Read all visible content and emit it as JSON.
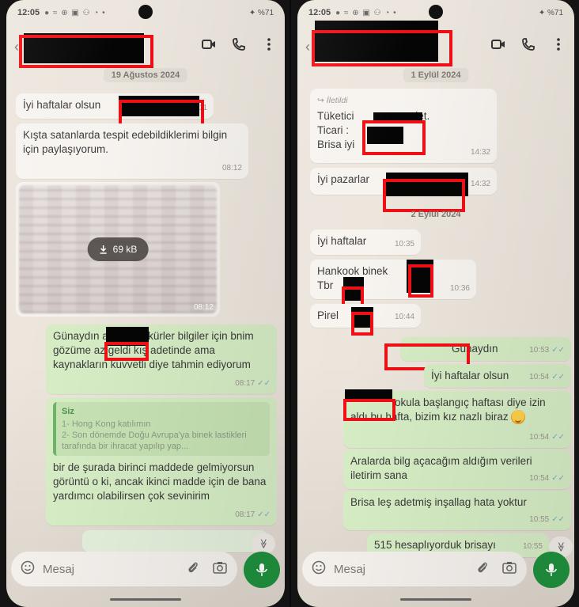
{
  "left": {
    "status": {
      "time": "12:05",
      "icons": "● ≈ ⊕ ▣ ⚇ ◔ •",
      "battery": "✦ %71"
    },
    "date_chip": "19 Ağustos 2024",
    "messages": [
      {
        "text": "İyi haftalar olsun",
        "time": "08:11"
      },
      {
        "text": "Kışta satanlarda tespit edebildiklerimi bilgin için paylaşıyorum.",
        "time": "08:12"
      },
      {
        "download_size": "69 kB",
        "time": "08:12"
      },
      {
        "text": "Günaydın abi, teşekkürler bilgiler için bnim gözüme az geldi kış adetinde ama kaynakların kuvvetli diye tahmin ediyorum",
        "time": "08:17"
      },
      {
        "quote_author": "Siz",
        "quote_line1": "1- Hong Kong katılımın",
        "quote_line2": "2- Son dönemde Doğu Avrupa'ya binek lastikleri tarafında bir ihracat yapılıp yap...",
        "text": "bir de şurada birinci maddede gelmiyorsun görüntü o ki, ancak ikinci madde için de bana yardımcı olabilirsen çok sevinirim",
        "time": "08:17"
      }
    ],
    "composer_placeholder": "Mesaj",
    "scroll_icon": "≫"
  },
  "right": {
    "status": {
      "time": "12:05",
      "icons": "● ≈ ⊕ ▣ ⚇ ◔ •",
      "battery": "✦ %71"
    },
    "date_chip_1": "1 Eylül 2024",
    "date_chip_2": "2 Eylül 2024",
    "messages": [
      {
        "forwarded": "İletildi",
        "line1": "Tüketici",
        "line1_end": "adet.",
        "line2": "Ticari :",
        "line3": "Brisa iyi",
        "time": "14:32"
      },
      {
        "text": "İyi pazarlar",
        "time": "14:32"
      },
      {
        "text": "İyi haftalar",
        "time": "10:35"
      },
      {
        "line1": "Hankook binek",
        "line2": "Tbr",
        "time": "10:36"
      },
      {
        "text": "Pirel",
        "time": "10:44"
      },
      {
        "text": "Günaydın",
        "time": "10:53"
      },
      {
        "text": "İyi haftalar olsun",
        "time": "10:54"
      },
      {
        "text_a": "okula başlangıç haftası diye",
        "text_b": "izin aldı",
        "text_c": "bu hafta, bizim kız nazlı biraz",
        "time": "10:54"
      },
      {
        "text": "Aralarda bilg açacağım aldığım verileri iletirim sana",
        "time": "10:54"
      },
      {
        "text": "Brisa leş adetmiş inşallag hata yoktur",
        "time": "10:55"
      },
      {
        "text": "515 hesaplıyorduk brisayı",
        "time": "10:55"
      }
    ],
    "composer_placeholder": "Mesaj",
    "scroll_icon": "≫"
  },
  "colors": {
    "incoming": "#f7f4f0",
    "outgoing": "#d5ecc4",
    "accent": "#1f8f3d",
    "redaction_box": "#f00f16"
  }
}
